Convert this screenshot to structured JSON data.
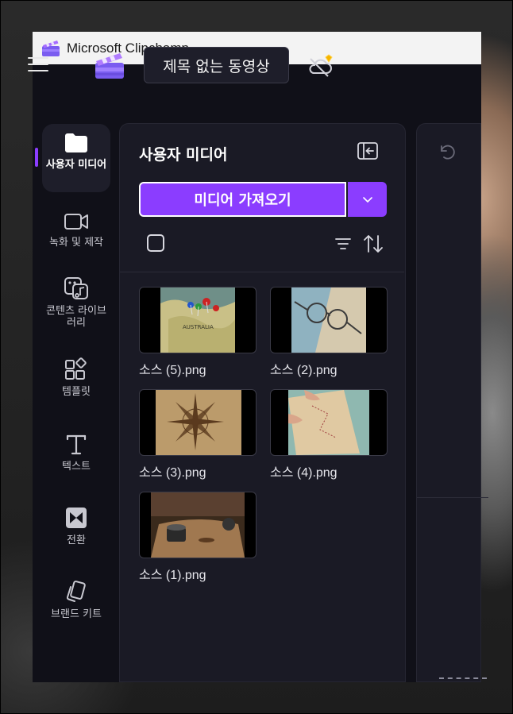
{
  "window": {
    "title": "Microsoft Clipchamp"
  },
  "header": {
    "project_title": "제목 없는 동영상"
  },
  "rail": {
    "items": [
      {
        "label": "사용자 미디어",
        "icon": "folder-icon",
        "active": true
      },
      {
        "label": "녹화 및 제작",
        "icon": "video-camera-icon"
      },
      {
        "label": "콘텐츠 라이브러리",
        "icon": "content-library-icon"
      },
      {
        "label": "템플릿",
        "icon": "templates-icon"
      },
      {
        "label": "텍스트",
        "icon": "text-icon"
      },
      {
        "label": "전환",
        "icon": "transitions-icon"
      },
      {
        "label": "브랜드 키트",
        "icon": "brand-kit-icon"
      }
    ]
  },
  "panel": {
    "title": "사용자 미디어",
    "import_label": "미디어 가져오기",
    "media": [
      {
        "name": "소스 (5).png"
      },
      {
        "name": "소스 (2).png"
      },
      {
        "name": "소스 (3).png"
      },
      {
        "name": "소스 (4).png"
      },
      {
        "name": "소스 (1).png"
      }
    ]
  },
  "colors": {
    "accent": "#8b3dff",
    "background": "#101018",
    "panel": "#1a1a25"
  }
}
